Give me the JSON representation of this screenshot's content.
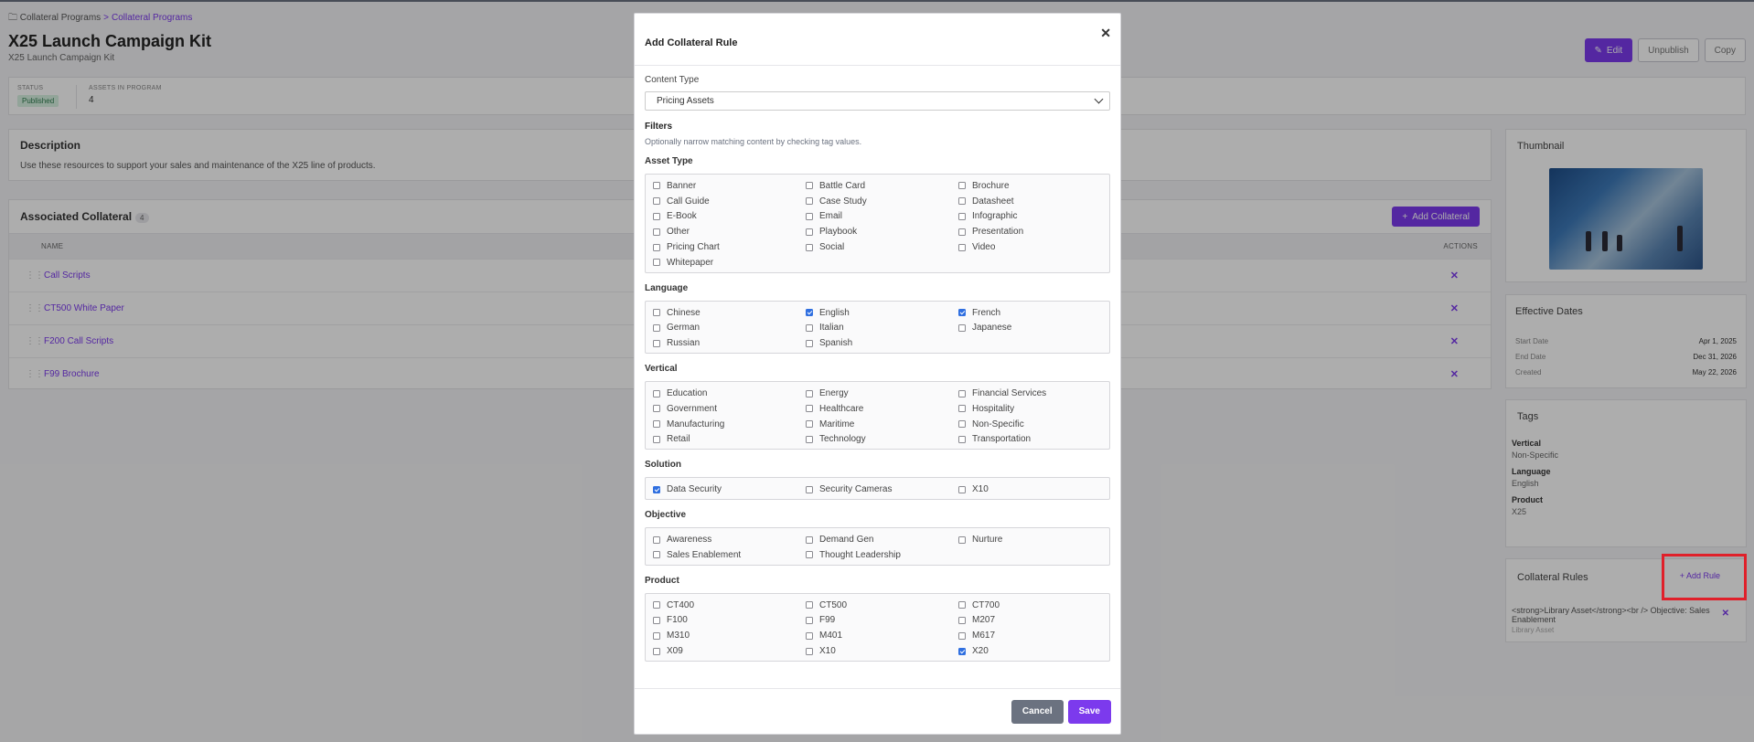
{
  "breadcrumb": {
    "root": "Collateral Programs",
    "current": "Collateral Programs"
  },
  "page": {
    "title": "X25 Launch Campaign Kit",
    "subtitle": "X25 Launch Campaign Kit"
  },
  "header_buttons": {
    "edit": "Edit",
    "unpublish": "Unpublish",
    "copy": "Copy"
  },
  "stats": {
    "status_label": "STATUS",
    "status_value": "Published",
    "assets_label": "ASSETS IN PROGRAM",
    "assets_value": "4"
  },
  "description": {
    "title": "Description",
    "text": "Use these resources to support your sales and maintenance of the X25 line of products."
  },
  "collateral": {
    "title": "Associated Collateral",
    "count": "4",
    "add_label": "Add Collateral",
    "col_name": "NAME",
    "col_actions": "ACTIONS",
    "rows": [
      "Call Scripts",
      "CT500 White Paper",
      "F200 Call Scripts",
      "F99 Brochure"
    ]
  },
  "thumbnail": {
    "title": "Thumbnail"
  },
  "dates": {
    "title": "Effective Dates",
    "rows": [
      {
        "label": "Start Date",
        "value": "Apr 1, 2025"
      },
      {
        "label": "End Date",
        "value": "Dec 31, 2026"
      },
      {
        "label": "Created",
        "value": "May 22, 2026"
      }
    ]
  },
  "tags": {
    "title": "Tags",
    "items": [
      {
        "key": "Vertical",
        "value": "Non-Specific"
      },
      {
        "key": "Language",
        "value": "English"
      },
      {
        "key": "Product",
        "value": "X25"
      }
    ]
  },
  "rules": {
    "title": "Collateral Rules",
    "add_label": "Add Rule",
    "items": [
      {
        "text": "<strong>Library Asset</strong><br /> Objective: Sales Enablement",
        "sub": "Library Asset"
      }
    ]
  },
  "modal": {
    "title": "Add Collateral Rule",
    "content_type_label": "Content Type",
    "content_type_value": "Pricing Assets",
    "filters_title": "Filters",
    "filters_hint": "Optionally narrow matching content by checking tag values.",
    "groups": [
      {
        "label": "Asset Type",
        "options": [
          {
            "label": "Banner",
            "checked": false
          },
          {
            "label": "Battle Card",
            "checked": false
          },
          {
            "label": "Brochure",
            "checked": false
          },
          {
            "label": "Call Guide",
            "checked": false
          },
          {
            "label": "Case Study",
            "checked": false
          },
          {
            "label": "Datasheet",
            "checked": false
          },
          {
            "label": "E-Book",
            "checked": false
          },
          {
            "label": "Email",
            "checked": false
          },
          {
            "label": "Infographic",
            "checked": false
          },
          {
            "label": "Other",
            "checked": false
          },
          {
            "label": "Playbook",
            "checked": false
          },
          {
            "label": "Presentation",
            "checked": false
          },
          {
            "label": "Pricing Chart",
            "checked": false
          },
          {
            "label": "Social",
            "checked": false
          },
          {
            "label": "Video",
            "checked": false
          },
          {
            "label": "Whitepaper",
            "checked": false
          }
        ]
      },
      {
        "label": "Language",
        "options": [
          {
            "label": "Chinese",
            "checked": false
          },
          {
            "label": "English",
            "checked": true
          },
          {
            "label": "French",
            "checked": true
          },
          {
            "label": "German",
            "checked": false
          },
          {
            "label": "Italian",
            "checked": false
          },
          {
            "label": "Japanese",
            "checked": false
          },
          {
            "label": "Russian",
            "checked": false
          },
          {
            "label": "Spanish",
            "checked": false
          }
        ]
      },
      {
        "label": "Vertical",
        "options": [
          {
            "label": "Education",
            "checked": false
          },
          {
            "label": "Energy",
            "checked": false
          },
          {
            "label": "Financial Services",
            "checked": false
          },
          {
            "label": "Government",
            "checked": false
          },
          {
            "label": "Healthcare",
            "checked": false
          },
          {
            "label": "Hospitality",
            "checked": false
          },
          {
            "label": "Manufacturing",
            "checked": false
          },
          {
            "label": "Maritime",
            "checked": false
          },
          {
            "label": "Non-Specific",
            "checked": false
          },
          {
            "label": "Retail",
            "checked": false
          },
          {
            "label": "Technology",
            "checked": false
          },
          {
            "label": "Transportation",
            "checked": false
          }
        ]
      },
      {
        "label": "Solution",
        "options": [
          {
            "label": "Data Security",
            "checked": true
          },
          {
            "label": "Security Cameras",
            "checked": false
          },
          {
            "label": "X10",
            "checked": false
          }
        ]
      },
      {
        "label": "Objective",
        "options": [
          {
            "label": "Awareness",
            "checked": false
          },
          {
            "label": "Demand Gen",
            "checked": false
          },
          {
            "label": "Nurture",
            "checked": false
          },
          {
            "label": "Sales Enablement",
            "checked": false
          },
          {
            "label": "Thought Leadership",
            "checked": false
          }
        ]
      },
      {
        "label": "Product",
        "options": [
          {
            "label": "CT400",
            "checked": false
          },
          {
            "label": "CT500",
            "checked": false
          },
          {
            "label": "CT700",
            "checked": false
          },
          {
            "label": "F100",
            "checked": false
          },
          {
            "label": "F99",
            "checked": false
          },
          {
            "label": "M207",
            "checked": false
          },
          {
            "label": "M310",
            "checked": false
          },
          {
            "label": "M401",
            "checked": false
          },
          {
            "label": "M617",
            "checked": false
          },
          {
            "label": "X09",
            "checked": false
          },
          {
            "label": "X10",
            "checked": false
          },
          {
            "label": "X20",
            "checked": true
          }
        ]
      }
    ],
    "cancel_label": "Cancel",
    "save_label": "Save"
  },
  "colors": {
    "accent": "#7c3aed",
    "checkbox": "#2f6fe0",
    "highlight": "#e0202a"
  }
}
